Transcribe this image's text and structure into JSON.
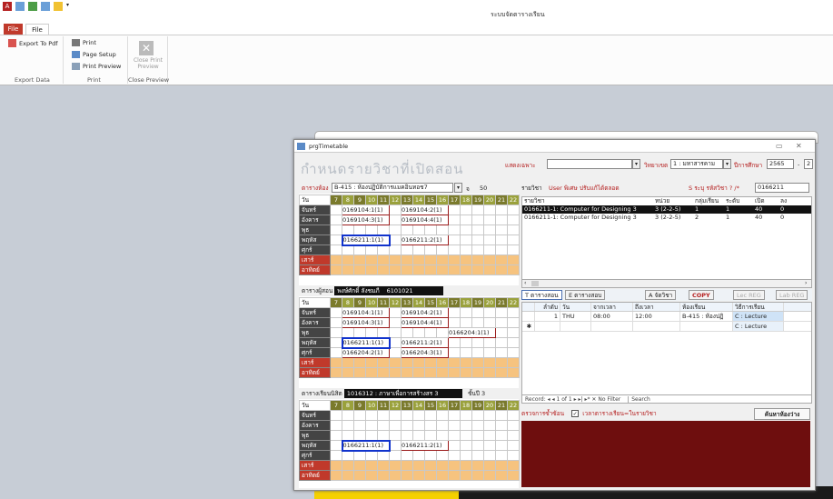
{
  "app": {
    "title": "ระบบจัดตารางเรียน"
  },
  "ribbon": {
    "tabs": [
      "File",
      "File"
    ],
    "export_pdf": "Export To Pdf",
    "print": "Print",
    "page_setup": "Page Setup",
    "print_preview": "Print Preview",
    "close_print_preview": "Close Print Preview",
    "groups": [
      "Export Data",
      "Print",
      "Close Preview"
    ]
  },
  "window": {
    "title": "prgTimetable",
    "heading": "กำหนดรายวิชาที่เปิดสอน",
    "show_only_label": "แสดงเฉพาะ",
    "show_only_value": "",
    "campus_label": "วิทยาเขต",
    "campus_value": "1 : มหาสารคาม",
    "year_label": "ปีการศึกษา",
    "year_value": "2565",
    "term_sep": "-",
    "term_value": "2"
  },
  "room": {
    "label": "ตารางห้อง",
    "value": "B-415 : ห้องปฏิบัติการแมคอินทอช7",
    "cap_label": "จ",
    "cap_value": "50"
  },
  "hours": [
    "7",
    "8",
    "9",
    "10",
    "11",
    "12",
    "13",
    "14",
    "15",
    "16",
    "17",
    "18",
    "19",
    "20",
    "21",
    "22"
  ],
  "day_header": "วัน",
  "days": [
    "จันทร์",
    "อังคาร",
    "พุธ",
    "พฤหัส",
    "ศุกร์",
    "เสาร์",
    "อาทิตย์"
  ],
  "room_cells": [
    [
      "0169104:1(1)",
      "0169104:2(1)",
      ""
    ],
    [
      "0169104:3(1)",
      "0169104:4(1)",
      ""
    ],
    [
      "",
      "",
      ""
    ],
    [
      "0166211:1(1)",
      "0166211:2(1)",
      ""
    ],
    [
      "",
      "",
      ""
    ]
  ],
  "teacher": {
    "label": "ตารางผู้สอน",
    "name": "พงษ์ศักดิ์ ลังชมภี",
    "id": "6101021",
    "cells": [
      [
        "0169104:1(1)",
        "0169104:2(1)",
        ""
      ],
      [
        "0169104:3(1)",
        "0169104:4(1)",
        ""
      ],
      [
        "",
        "",
        "0166204:1(1)"
      ],
      [
        "0166211:1(1)",
        "0166211:2(1)",
        ""
      ],
      [
        "0166204:2(1)",
        "0166204:3(1)",
        ""
      ]
    ]
  },
  "student": {
    "label": "ตารางเรียนนิสิต",
    "program": "1016312 : ภาษาเพื่อการสร้างสร",
    "year": "3",
    "year_label": "ชั้นปี",
    "year_value": "3",
    "cells": [
      [
        "",
        "",
        ""
      ],
      [
        "",
        "",
        ""
      ],
      [
        "",
        "",
        ""
      ],
      [
        "0166211:1(1)",
        "0166211:2(1)",
        ""
      ],
      [
        "",
        "",
        ""
      ]
    ]
  },
  "course_list": {
    "label": "รายวิชา",
    "user_note": "User พิเศษ ปรับแก้ได้ตลอด",
    "code_label": "S ระบุ รหัสวิชา ? /*",
    "code_value": "0166211",
    "headers": [
      "รายวิชา",
      "หน่วย",
      "กลุ่มเรียน",
      "ระดับ",
      "เปิด",
      "ลง"
    ],
    "rows": [
      [
        "0166211-1: Computer for Designing 3",
        "3 (2-2-5)",
        "1",
        "1",
        "40",
        "0"
      ],
      [
        "0166211-1: Computer for Designing 3",
        "3 (2-2-5)",
        "2",
        "1",
        "40",
        "0"
      ]
    ]
  },
  "buttons": {
    "tab_teach": "T ตารางสอน",
    "tab_exam": "E ตารางสอบ",
    "assign": "A จัดวิชา",
    "copy": "COPY",
    "lec_reg": "Lec REG",
    "lab_reg": "Lab REG",
    "find_room": "ค้นหาห้องว่าง"
  },
  "subgrid": {
    "headers": [
      "ลำดับ",
      "วัน",
      "จากเวลา",
      "ถึงเวลา",
      "ห้องเรียน",
      "วิธีการเรียน"
    ],
    "rows": [
      [
        "1",
        "THU",
        "08:00",
        "12:00",
        "B-415 : ห้องปฏิ",
        "C : Lecture"
      ],
      [
        "",
        "",
        "",
        "",
        "",
        "C : Lecture"
      ]
    ]
  },
  "nav": {
    "text": "Record: ◂  ◂ 1 of 1  ▸ ▸| ▸*  ✕ No Filter",
    "search": "Search"
  },
  "check": {
    "label": "ตรวจการซ้ำซ้อน",
    "option": "เวลาตารางเรียน=ในรายวิชา"
  },
  "colors": {
    "accent_red": "#c0392b",
    "hour_olive": "#7a7a2c",
    "weekend": "#f6c37f",
    "dark_panel": "#6e0e0e"
  }
}
